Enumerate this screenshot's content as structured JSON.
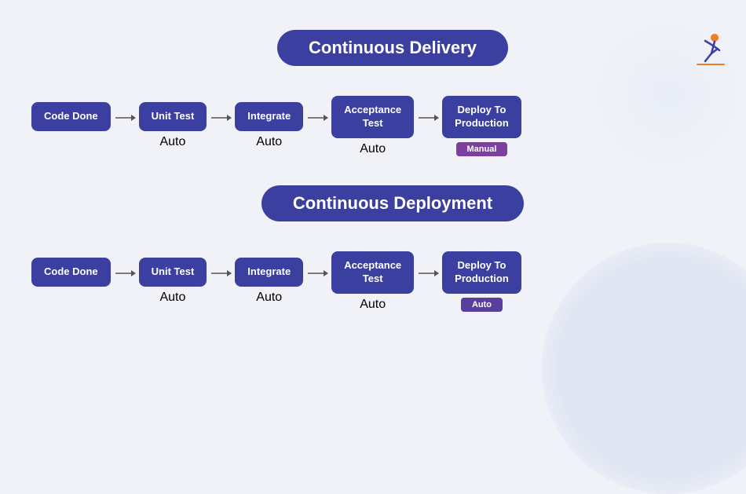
{
  "logo": {
    "alt": "brand-logo"
  },
  "delivery": {
    "title": "Continuous Delivery",
    "pipeline": [
      {
        "label": "Code Done",
        "sublabel": "",
        "sublabel_type": ""
      },
      {
        "label": "Unit Test",
        "sublabel": "Auto",
        "sublabel_type": "text"
      },
      {
        "label": "Integrate",
        "sublabel": "Auto",
        "sublabel_type": "text"
      },
      {
        "label": "Acceptance\nTest",
        "sublabel": "Auto",
        "sublabel_type": "text"
      },
      {
        "label": "Deploy To\nProduction",
        "sublabel": "Manual",
        "sublabel_type": "badge-manual"
      }
    ]
  },
  "deployment": {
    "title": "Continuous Deployment",
    "pipeline": [
      {
        "label": "Code Done",
        "sublabel": "",
        "sublabel_type": ""
      },
      {
        "label": "Unit Test",
        "sublabel": "Auto",
        "sublabel_type": "text"
      },
      {
        "label": "Integrate",
        "sublabel": "Auto",
        "sublabel_type": "text"
      },
      {
        "label": "Acceptance\nTest",
        "sublabel": "Auto",
        "sublabel_type": "text"
      },
      {
        "label": "Deploy To\nProduction",
        "sublabel": "Auto",
        "sublabel_type": "badge-auto"
      }
    ]
  }
}
